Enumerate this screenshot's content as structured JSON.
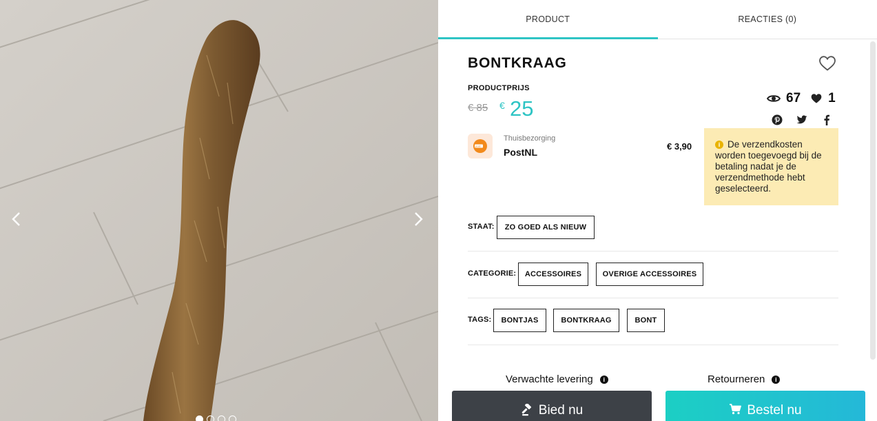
{
  "gallery": {
    "prev_icon": "chevron-left-icon",
    "next_icon": "chevron-right-icon",
    "slide_count": 4,
    "active_slide": 1
  },
  "tabs": [
    {
      "label": "PRODUCT",
      "active": true
    },
    {
      "label": "REACTIES (0)",
      "active": false
    }
  ],
  "product": {
    "title": "BONTKRAAG",
    "price_label": "PRODUCTPRIJS",
    "old_price": "€ 85",
    "currency": "€",
    "price": "25",
    "views": "67",
    "likes": "1"
  },
  "share_icons": [
    "pinterest-icon",
    "twitter-icon",
    "facebook-icon"
  ],
  "shipping": {
    "type": "Thuisbezorging",
    "carrier": "PostNL",
    "price": "€ 3,90",
    "notice": "De verzendkosten worden toegevoegd bij de betaling nadat je de verzendmethode hebt geselecteerd."
  },
  "details": {
    "condition_label": "STAAT:",
    "condition": "ZO GOED ALS NIEUW",
    "category_label": "CATEGORIE:",
    "categories": [
      "ACCESSOIRES",
      "OVERIGE ACCESSOIRES"
    ],
    "tags_label": "TAGS:",
    "tags": [
      "BONTJAS",
      "BONTKRAAG",
      "BONT"
    ]
  },
  "info": {
    "delivery": "Verwachte levering",
    "returns": "Retourneren"
  },
  "actions": {
    "bid": "Bied nu",
    "buy": "Bestel nu"
  },
  "colors": {
    "accent": "#2ec4c4",
    "notice_bg": "#fcebb4",
    "bid_button": "#3d4147"
  }
}
